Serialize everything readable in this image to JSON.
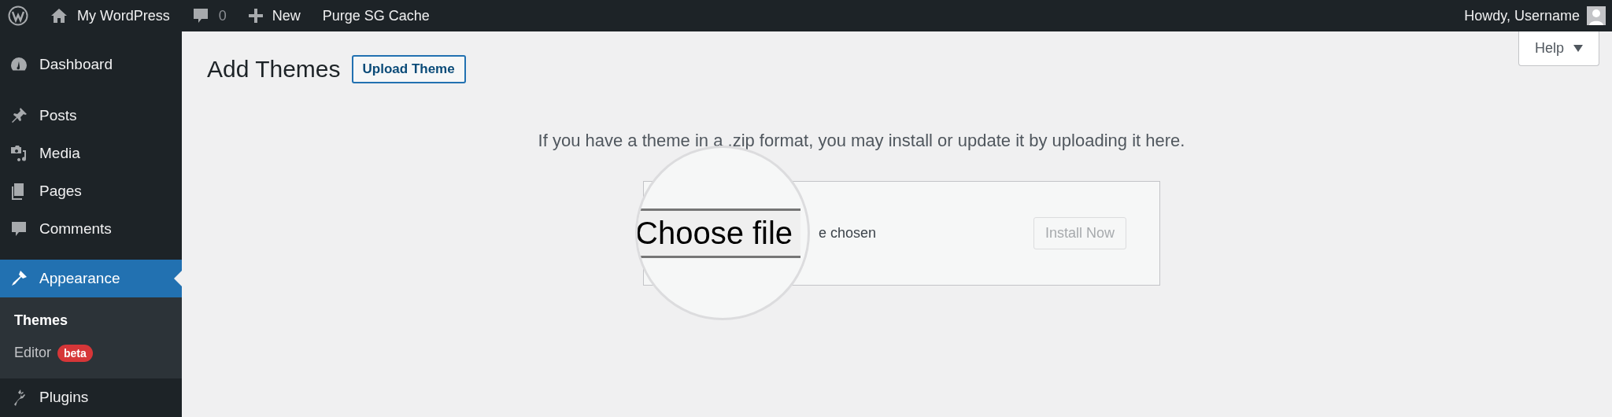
{
  "admin_bar": {
    "site_name": "My WordPress",
    "comments_count": "0",
    "new_label": "New",
    "purge_label": "Purge SG Cache",
    "greeting": "Howdy, Username"
  },
  "sidebar": {
    "items": [
      {
        "label": "Dashboard",
        "selected": false
      },
      {
        "label": "Posts",
        "selected": false
      },
      {
        "label": "Media",
        "selected": false
      },
      {
        "label": "Pages",
        "selected": false
      },
      {
        "label": "Comments",
        "selected": false
      },
      {
        "label": "Appearance",
        "selected": true,
        "children": [
          {
            "label": "Themes",
            "selected": true
          },
          {
            "label": "Editor",
            "selected": false,
            "badge": "beta"
          }
        ]
      },
      {
        "label": "Plugins",
        "selected": false
      }
    ]
  },
  "help_button": {
    "label": "Help"
  },
  "page": {
    "title": "Add Themes",
    "upload_button": "Upload Theme",
    "intro": "If you have a theme in a .zip format, you may install or update it by uploading it here.",
    "file_input": {
      "button_label": "Choose file",
      "status_text": "e chosen"
    },
    "install_button": {
      "label": "Install Now",
      "disabled": true
    }
  }
}
